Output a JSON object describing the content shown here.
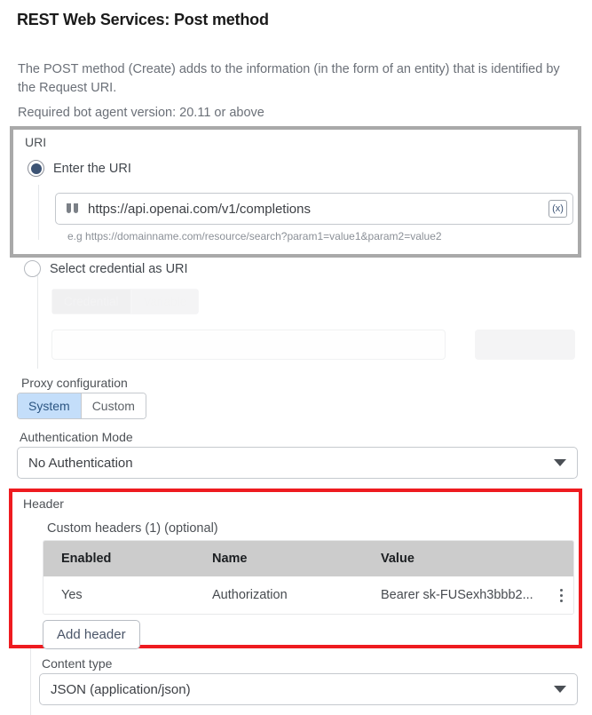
{
  "page": {
    "title": "REST Web Services: Post method",
    "description": "The POST method (Create) adds to the information (in the form of an entity) that is identified by the Request URI.",
    "required_version": "Required bot agent version: 20.11 or above"
  },
  "uri_section": {
    "group_label": "URI",
    "option_enter": "Enter the URI",
    "option_credential": "Select credential as URI",
    "uri_value": "https://api.openai.com/v1/completions",
    "uri_hint": "e.g https://domainname.com/resource/search?param1=value1&param2=value2",
    "variable_button": "(x)",
    "quote_icon": "quote-icon",
    "credential_tabs": [
      {
        "label": "Credential",
        "selected": true
      },
      {
        "label": "Variable",
        "selected": false
      }
    ],
    "credential_input_value": "",
    "credential_button_label": ""
  },
  "proxy": {
    "label": "Proxy configuration",
    "options": [
      {
        "label": "System",
        "selected": true
      },
      {
        "label": "Custom",
        "selected": false
      }
    ]
  },
  "authentication": {
    "label": "Authentication Mode",
    "value": "No Authentication"
  },
  "header_section": {
    "group_label": "Header",
    "custom_headers_label": "Custom headers (1) (optional)",
    "columns": [
      "Enabled",
      "Name",
      "Value"
    ],
    "rows": [
      {
        "enabled": "Yes",
        "name": "Authorization",
        "value": "Bearer sk-FUSexh3bbb2..."
      }
    ],
    "add_header_label": "Add header",
    "highlight_color": "#ee1b20"
  },
  "content_type": {
    "label": "Content type",
    "value": "JSON (application/json)"
  }
}
